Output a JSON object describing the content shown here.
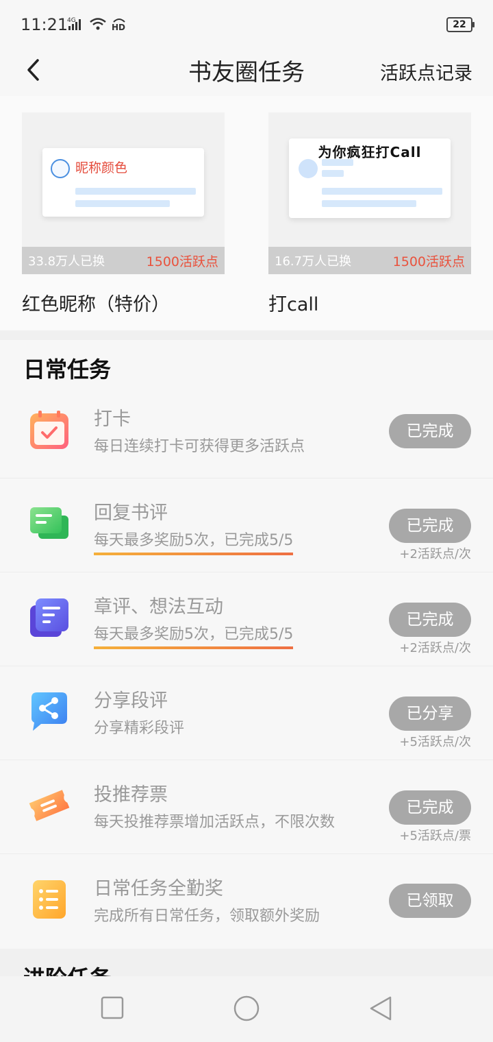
{
  "status_bar": {
    "time": "11:21",
    "network": "4G",
    "hd": "HD",
    "battery": "22"
  },
  "nav": {
    "title": "书友圈任务",
    "action": "活跃点记录"
  },
  "shop": {
    "items": [
      {
        "title": "红色昵称（特价）",
        "count": "33.8万人已换",
        "price": "1500活跃点",
        "preview_label": "昵称颜色"
      },
      {
        "title": "打call",
        "count": "16.7万人已换",
        "price": "1500活跃点",
        "preview_label": "为你疯狂打Call"
      }
    ]
  },
  "daily": {
    "title": "日常任务",
    "tasks": [
      {
        "name": "打卡",
        "desc": "每日连续打卡可获得更多活跃点",
        "button": "已完成",
        "reward": "",
        "icon": "calendar-check-icon"
      },
      {
        "name": "回复书评",
        "desc": "每天最多奖励5次，已完成5/5",
        "button": "已完成",
        "reward": "+2活跃点/次",
        "icon": "chat-bubble-icon"
      },
      {
        "name": "章评、想法互动",
        "desc": "每天最多奖励5次，已完成5/5",
        "button": "已完成",
        "reward": "+2活跃点/次",
        "icon": "document-icon"
      },
      {
        "name": "分享段评",
        "desc": "分享精彩段评",
        "button": "已分享",
        "reward": "+5活跃点/次",
        "icon": "share-icon"
      },
      {
        "name": "投推荐票",
        "desc": "每天投推荐票增加活跃点，不限次数",
        "button": "已完成",
        "reward": "+5活跃点/票",
        "icon": "ticket-icon"
      },
      {
        "name": "日常任务全勤奖",
        "desc": "完成所有日常任务，领取额外奖励",
        "button": "已领取",
        "reward": "",
        "icon": "list-icon"
      }
    ]
  },
  "next_section": {
    "title": "进阶任务"
  },
  "colors": {
    "accent_red": "#e9523d",
    "button_gray": "#a8a8a8",
    "underline_orange": "#f2a43c"
  }
}
